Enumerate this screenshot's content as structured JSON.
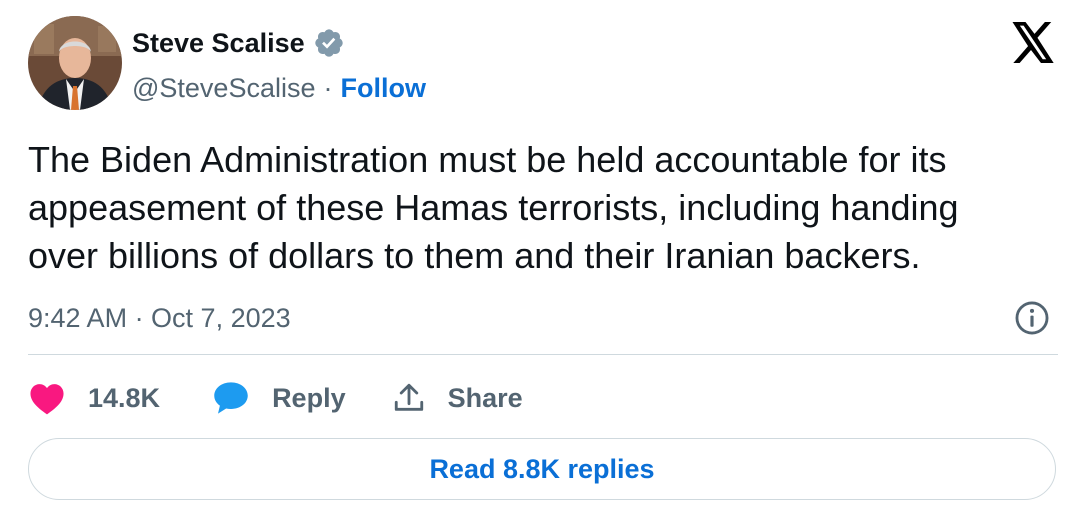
{
  "author": {
    "name": "Steve Scalise",
    "handle": "@SteveScalise",
    "separator": "·",
    "follow_label": "Follow",
    "avatar_icon": "avatar-photo",
    "verified_icon": "verified-badge-icon",
    "verified_color": "#829aab"
  },
  "brand": {
    "logo_icon": "x-logo-icon",
    "color": "#000000"
  },
  "tweet": {
    "lines": [
      "The Biden Administration must be held accountable for its",
      "appeasement of these Hamas terrorists, including handing",
      "over billions of dollars to them and their Iranian backers."
    ],
    "timestamp": "9:42 AM · Oct 7, 2023",
    "info_icon": "info-icon"
  },
  "actions": {
    "like_count": "14.8K",
    "like_icon": "heart-icon",
    "like_color": "#f91880",
    "reply_label": "Reply",
    "reply_icon": "speech-bubble-icon",
    "reply_color": "#1d9bf0",
    "share_label": "Share",
    "share_icon": "share-upload-icon"
  },
  "read_replies_label": "Read 8.8K replies",
  "colors": {
    "text": "#0f1419",
    "secondary": "#536471",
    "link": "#0a6fd6",
    "border": "#cfd9de"
  }
}
